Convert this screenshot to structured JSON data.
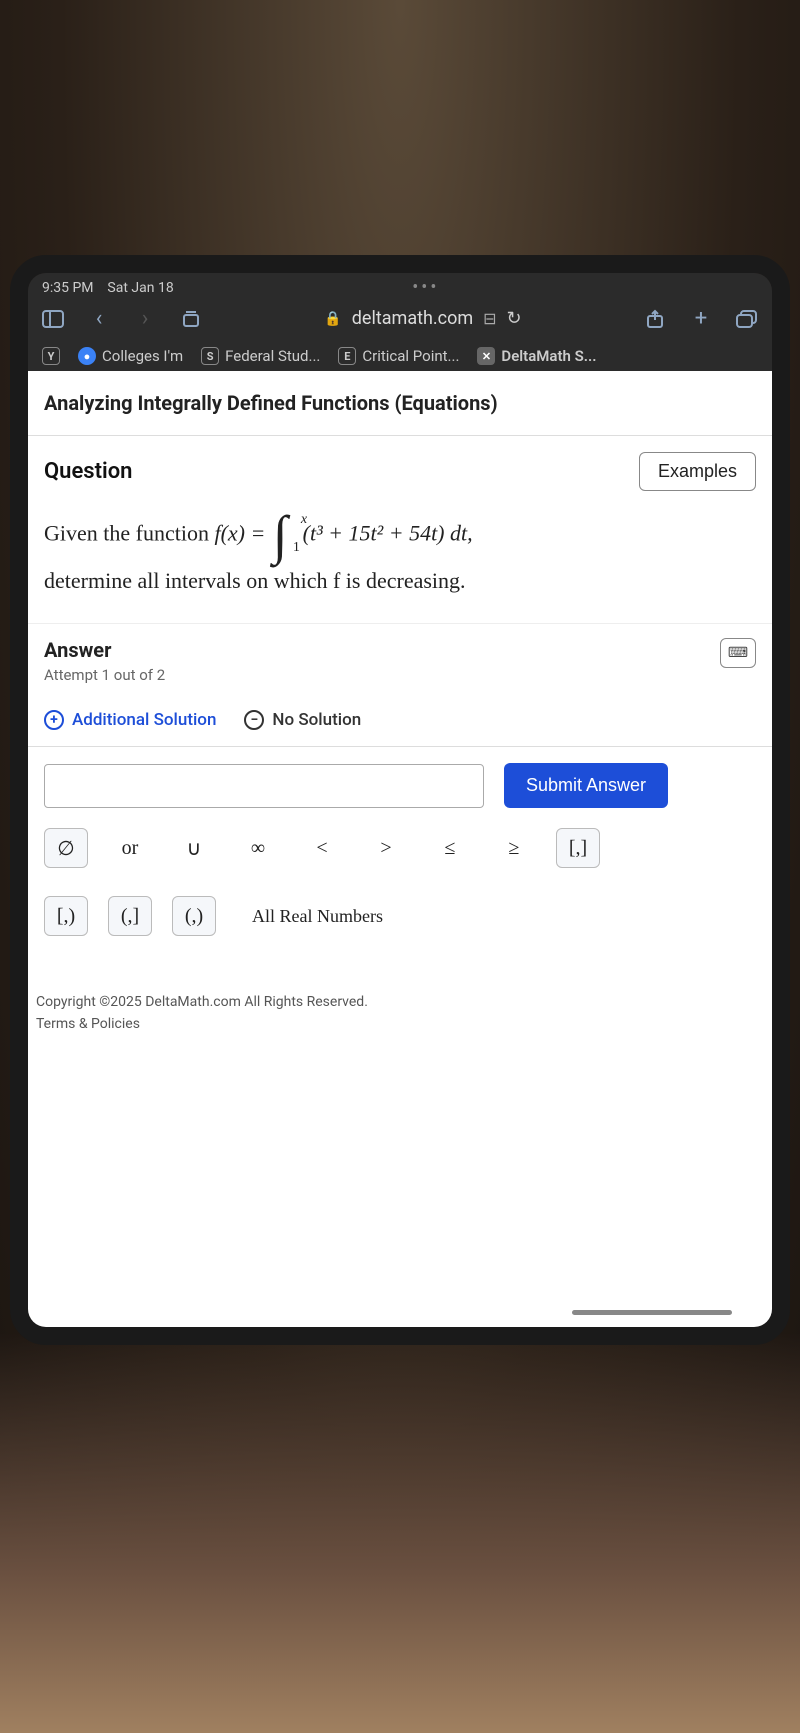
{
  "status": {
    "time": "9:35 PM",
    "date": "Sat Jan 18"
  },
  "browser": {
    "url": "deltamath.com",
    "tabs": {
      "t1": "Colleges I'm",
      "t2": "Federal Stud...",
      "t3": "Critical Point...",
      "t4": "DeltaMath S..."
    }
  },
  "page": {
    "topic": "Analyzing Integrally Defined Functions (Equations)",
    "question_label": "Question",
    "examples_label": "Examples",
    "prompt_lead": "Given the function ",
    "func_name": "f(x) = ",
    "integrand": "(t³ + 15t² + 54t) dt,",
    "upper_limit": "x",
    "lower_limit": "1",
    "prompt_trail": "determine all intervals on which f is decreasing.",
    "answer_label": "Answer",
    "attempt": "Attempt 1 out of 2",
    "additional_solution": "Additional Solution",
    "no_solution": "No Solution",
    "submit": "Submit Answer",
    "keys": {
      "phi": "∅",
      "or": "or",
      "union": "∪",
      "inf": "∞",
      "lt": "<",
      "gt": ">",
      "le": "≤",
      "ge": "≥",
      "cc": "[,]",
      "co": "[,)",
      "oc": "(,]",
      "oo": "(,)",
      "all_real": "All Real Numbers"
    },
    "copyright": "Copyright ©2025 DeltaMath.com All Rights Reserved.",
    "terms": "Terms & Policies"
  }
}
